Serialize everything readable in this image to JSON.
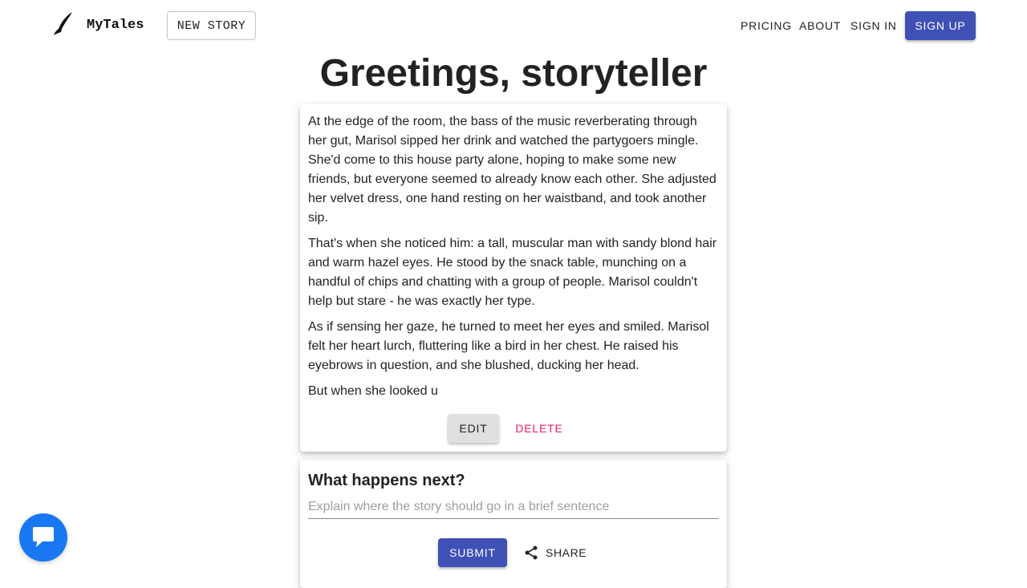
{
  "header": {
    "brand": "MyTales",
    "new_story_label": "NEW STORY",
    "nav": {
      "pricing": "PRICING",
      "about": "ABOUT",
      "sign_in": "SIGN IN",
      "sign_up": "SIGN UP"
    },
    "logo_icon": "quill-icon"
  },
  "main": {
    "headline": "Greetings, storyteller",
    "story": {
      "paragraphs": [
        "At the edge of the room, the bass of the music reverberating through her gut, Marisol sipped her drink and watched the partygoers mingle. She'd come to this house party alone, hoping to make some new friends, but everyone seemed to already know each other. She adjusted her velvet dress, one hand resting on her waistband, and took another sip.",
        "That's when she noticed him: a tall, muscular man with sandy blond hair and warm hazel eyes. He stood by the snack table, munching on a handful of chips and chatting with a group of people. Marisol couldn't help but stare - he was exactly her type.",
        "As if sensing her gaze, he turned to meet her eyes and smiled. Marisol felt her heart lurch, fluttering like a bird in her chest. He raised his eyebrows in question, and she blushed, ducking her head.",
        "But when she looked u"
      ],
      "edit_label": "EDIT",
      "delete_label": "DELETE"
    },
    "next": {
      "title": "What happens next?",
      "input_value": "",
      "input_placeholder": "Explain where the story should go in a brief sentence",
      "submit_label": "SUBMIT",
      "share_label": "SHARE",
      "share_icon": "share-icon"
    }
  },
  "chat_widget": {
    "icon": "chat-bubble-icon"
  },
  "colors": {
    "primary": "#3f51b5",
    "danger": "#e91e63",
    "chat_fab": "#1877f2",
    "edit_bg": "#e0e0e0"
  }
}
